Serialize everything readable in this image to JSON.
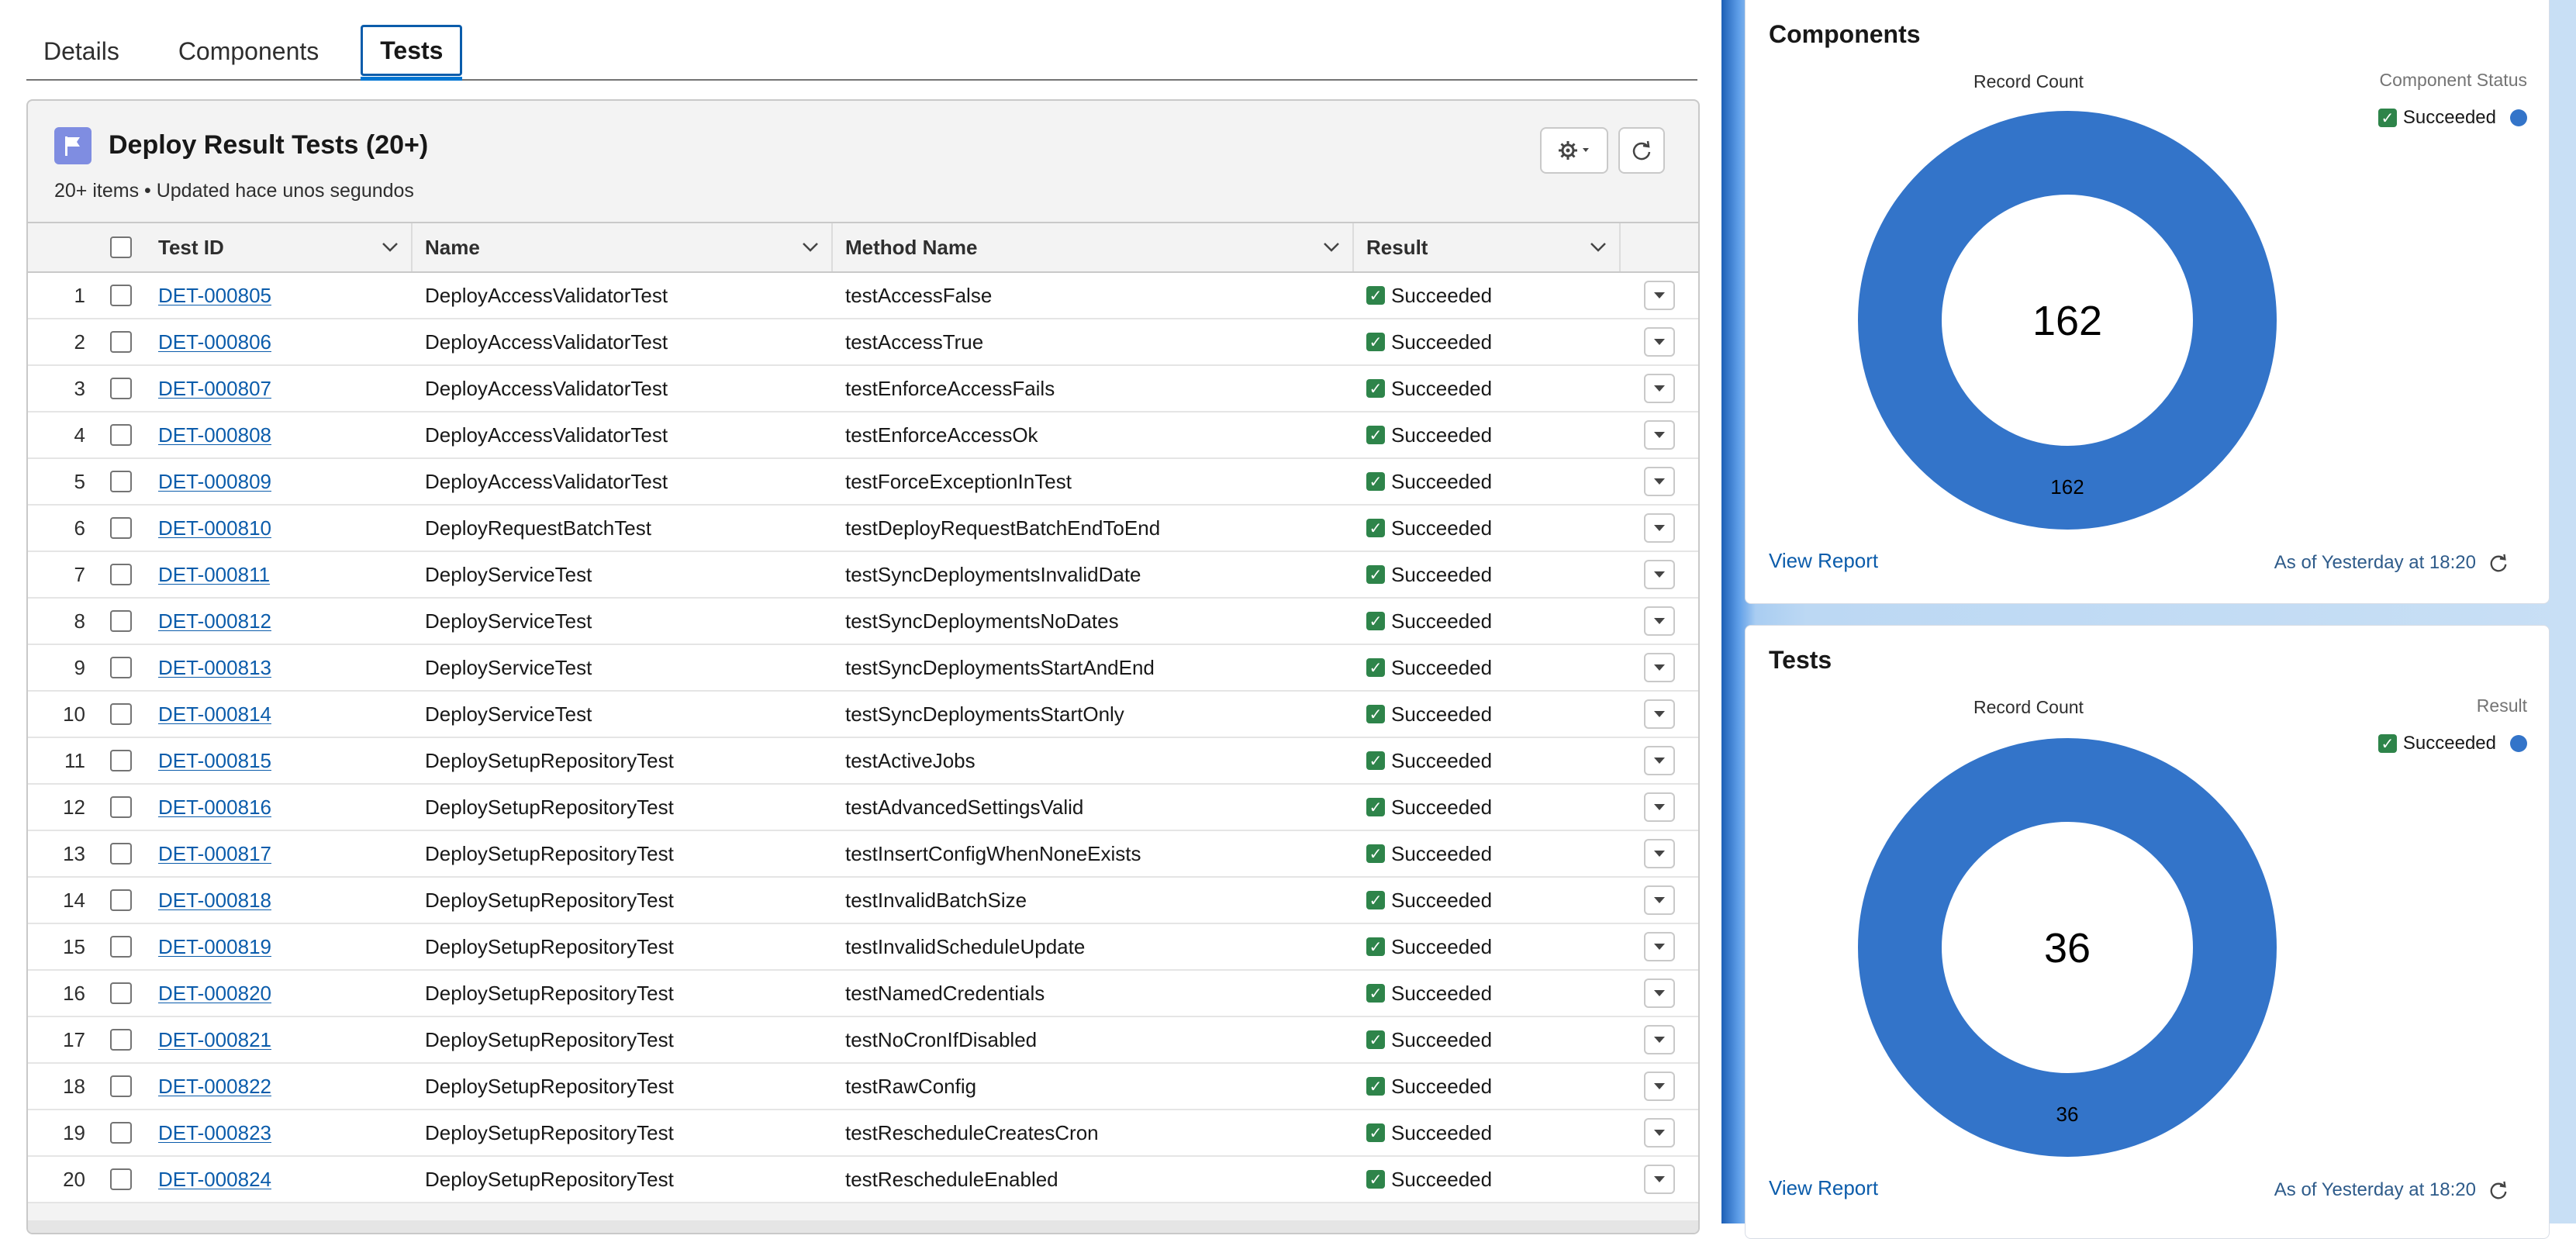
{
  "tabs": [
    {
      "label": "Details",
      "active": false
    },
    {
      "label": "Components",
      "active": false
    },
    {
      "label": "Tests",
      "active": true
    }
  ],
  "card": {
    "title": "Deploy Result Tests (20+)",
    "subtitle": "20+ items • Updated hace unos segundos",
    "icon": "flag-icon",
    "actions": [
      "gear-dropdown-icon",
      "refresh-icon"
    ]
  },
  "table": {
    "columns": [
      "Test ID",
      "Name",
      "Method Name",
      "Result"
    ],
    "rows": [
      {
        "num": "1",
        "id": "DET-000805",
        "name": "DeployAccessValidatorTest",
        "method": "testAccessFalse",
        "result": "Succeeded"
      },
      {
        "num": "2",
        "id": "DET-000806",
        "name": "DeployAccessValidatorTest",
        "method": "testAccessTrue",
        "result": "Succeeded"
      },
      {
        "num": "3",
        "id": "DET-000807",
        "name": "DeployAccessValidatorTest",
        "method": "testEnforceAccessFails",
        "result": "Succeeded"
      },
      {
        "num": "4",
        "id": "DET-000808",
        "name": "DeployAccessValidatorTest",
        "method": "testEnforceAccessOk",
        "result": "Succeeded"
      },
      {
        "num": "5",
        "id": "DET-000809",
        "name": "DeployAccessValidatorTest",
        "method": "testForceExceptionInTest",
        "result": "Succeeded"
      },
      {
        "num": "6",
        "id": "DET-000810",
        "name": "DeployRequestBatchTest",
        "method": "testDeployRequestBatchEndToEnd",
        "result": "Succeeded"
      },
      {
        "num": "7",
        "id": "DET-000811",
        "name": "DeployServiceTest",
        "method": "testSyncDeploymentsInvalidDate",
        "result": "Succeeded"
      },
      {
        "num": "8",
        "id": "DET-000812",
        "name": "DeployServiceTest",
        "method": "testSyncDeploymentsNoDates",
        "result": "Succeeded"
      },
      {
        "num": "9",
        "id": "DET-000813",
        "name": "DeployServiceTest",
        "method": "testSyncDeploymentsStartAndEnd",
        "result": "Succeeded"
      },
      {
        "num": "10",
        "id": "DET-000814",
        "name": "DeployServiceTest",
        "method": "testSyncDeploymentsStartOnly",
        "result": "Succeeded"
      },
      {
        "num": "11",
        "id": "DET-000815",
        "name": "DeploySetupRepositoryTest",
        "method": "testActiveJobs",
        "result": "Succeeded"
      },
      {
        "num": "12",
        "id": "DET-000816",
        "name": "DeploySetupRepositoryTest",
        "method": "testAdvancedSettingsValid",
        "result": "Succeeded"
      },
      {
        "num": "13",
        "id": "DET-000817",
        "name": "DeploySetupRepositoryTest",
        "method": "testInsertConfigWhenNoneExists",
        "result": "Succeeded"
      },
      {
        "num": "14",
        "id": "DET-000818",
        "name": "DeploySetupRepositoryTest",
        "method": "testInvalidBatchSize",
        "result": "Succeeded"
      },
      {
        "num": "15",
        "id": "DET-000819",
        "name": "DeploySetupRepositoryTest",
        "method": "testInvalidScheduleUpdate",
        "result": "Succeeded"
      },
      {
        "num": "16",
        "id": "DET-000820",
        "name": "DeploySetupRepositoryTest",
        "method": "testNamedCredentials",
        "result": "Succeeded"
      },
      {
        "num": "17",
        "id": "DET-000821",
        "name": "DeploySetupRepositoryTest",
        "method": "testNoCronIfDisabled",
        "result": "Succeeded"
      },
      {
        "num": "18",
        "id": "DET-000822",
        "name": "DeploySetupRepositoryTest",
        "method": "testRawConfig",
        "result": "Succeeded"
      },
      {
        "num": "19",
        "id": "DET-000823",
        "name": "DeploySetupRepositoryTest",
        "method": "testRescheduleCreatesCron",
        "result": "Succeeded"
      },
      {
        "num": "20",
        "id": "DET-000824",
        "name": "DeploySetupRepositoryTest",
        "method": "testRescheduleEnabled",
        "result": "Succeeded"
      }
    ]
  },
  "components_panel": {
    "title": "Components",
    "record_count_label": "Record Count",
    "legend_title": "Component Status",
    "legend_item": "Succeeded",
    "total": "162",
    "segment_label": "162",
    "view_report": "View Report",
    "as_of": "As of Yesterday at 18:20"
  },
  "tests_panel": {
    "title": "Tests",
    "record_count_label": "Record Count",
    "legend_title": "Result",
    "legend_item": "Succeeded",
    "total": "36",
    "segment_label": "36",
    "view_report": "View Report",
    "as_of": "As of Yesterday at 18:20"
  },
  "colors": {
    "accent": "#0176d3",
    "link": "#0b5cab",
    "donut": "#3374c9",
    "success": "#2e844a",
    "flag_bg": "#7f8de1"
  }
}
